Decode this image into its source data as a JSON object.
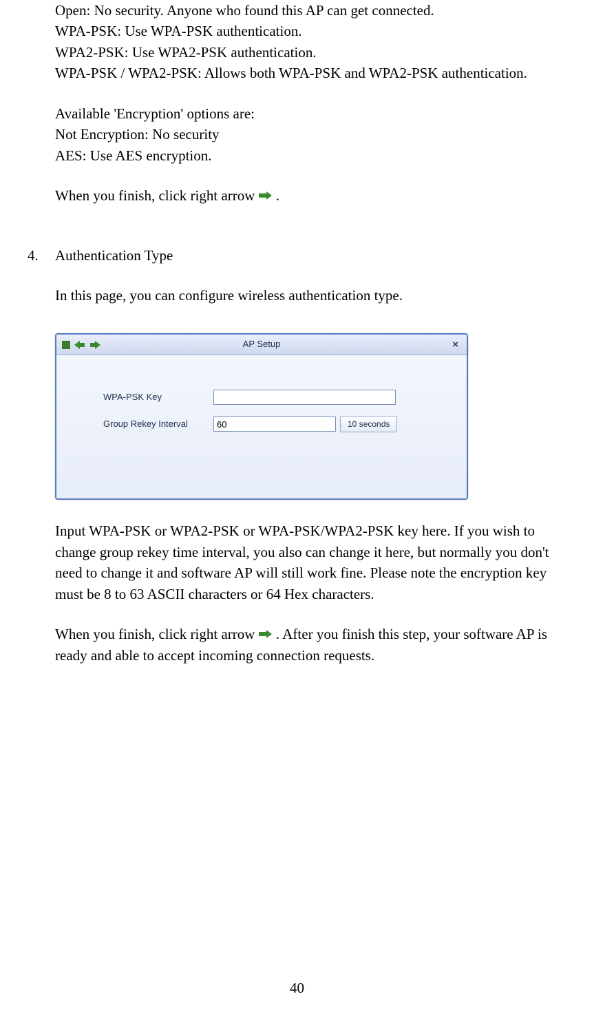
{
  "intro": {
    "p1": "Open: No security. Anyone who found this AP can get connected.",
    "p2": "WPA-PSK: Use WPA-PSK authentication.",
    "p3": "WPA2-PSK: Use WPA2-PSK authentication.",
    "p4": "WPA-PSK / WPA2-PSK: Allows both WPA-PSK and WPA2-PSK authentication.",
    "p5": "Available 'Encryption' options are:",
    "p6": "Not Encryption: No security",
    "p7": "AES: Use AES encryption.",
    "p8a": "When you finish, click right arrow ",
    "p8b": " ."
  },
  "item4": {
    "num": "4.",
    "title": "Authentication Type",
    "desc": "In this page, you can configure wireless authentication type.",
    "post1": "Input WPA-PSK or WPA2-PSK or WPA-PSK/WPA2-PSK key here. If you wish to change group rekey time interval, you also can change it here, but normally you don't need to change it and software AP will still work fine. Please note the encryption key must be 8 to 63 ASCII characters or 64 Hex characters.",
    "post2a": "When you finish, click right arrow ",
    "post2b": ". After you finish this step, your software AP is ready and able to accept incoming connection requests."
  },
  "dialog": {
    "title": "AP Setup",
    "close": "×",
    "wpa_label": "WPA-PSK Key",
    "wpa_value": "",
    "interval_label": "Group Rekey Interval",
    "interval_value": "60",
    "unit_value": "10 seconds"
  },
  "page_number": "40"
}
